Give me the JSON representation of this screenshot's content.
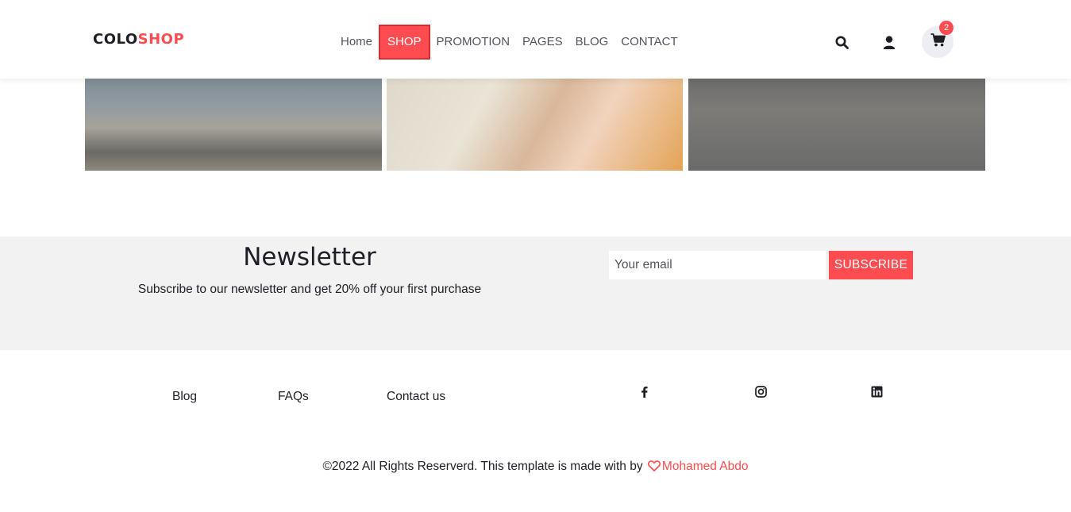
{
  "header": {
    "logo_part1": "COLO",
    "logo_part2": "SHOP",
    "nav": [
      {
        "label": "Home"
      },
      {
        "label": "SHOP"
      },
      {
        "label": "PROMOTION"
      },
      {
        "label": "PAGES"
      },
      {
        "label": "BLOG"
      },
      {
        "label": "CONTACT"
      }
    ],
    "active_nav": "SHOP",
    "icons": [
      "search-icon",
      "user-icon",
      "cart-icon"
    ],
    "cart_count": "2"
  },
  "newsletter": {
    "title": "Newsletter",
    "subtitle": "Subscribe to our newsletter and get 20% off your first purchase",
    "email_placeholder": "Your email",
    "button_label": "SUBSCRIBE"
  },
  "footer": {
    "links": [
      "Blog",
      "FAQs",
      "Contact us"
    ],
    "social_icons": [
      "facebook-icon",
      "instagram-icon",
      "linkedin-icon"
    ],
    "copyright_text": "©2022 All Rights Reserverd. This template is made with by",
    "author": "Mohamed Abdo"
  },
  "colors": {
    "accent": "#fe4c50",
    "text_dark": "#1e1e27",
    "newsletter_bg": "#f2f2f2"
  }
}
